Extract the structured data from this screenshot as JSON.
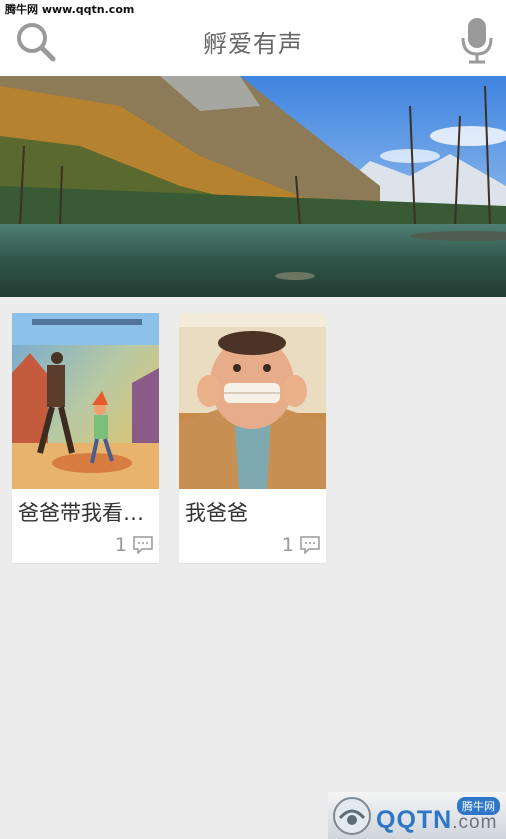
{
  "watermark_top": "腾牛网 www.qqtn.com",
  "header": {
    "title": "孵爱有声"
  },
  "books": [
    {
      "title": "爸爸带我看…",
      "comment_count": "1"
    },
    {
      "title": "我爸爸",
      "comment_count": "1"
    }
  ],
  "logo": {
    "text": "QQTN",
    "suffix": ".com",
    "badge": "腾牛网"
  },
  "colors": {
    "background": "#ececec",
    "header": "#ffffff",
    "icon_gray": "#9a9a9a",
    "title": "#666666"
  }
}
